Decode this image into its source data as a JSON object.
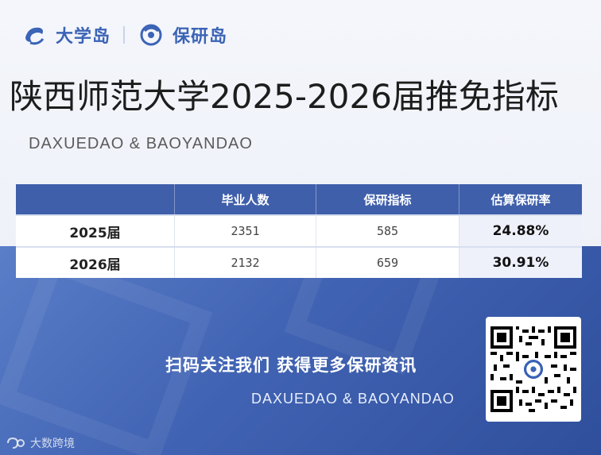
{
  "brand": {
    "name_1": "大学岛",
    "name_2": "保研岛",
    "icon_1": "daxuedao-logo-icon",
    "icon_2": "baoyandao-logo-icon",
    "color": "#3b63b6"
  },
  "title": "陕西师范大学2025-2026届推免指标",
  "subtitle": "DAXUEDAO & BAOYANDAO",
  "table": {
    "headers": [
      "",
      "毕业人数",
      "保研指标",
      "估算保研率"
    ],
    "rows": [
      {
        "year": "2025届",
        "graduates": "2351",
        "quota": "585",
        "rate": "24.88%"
      },
      {
        "year": "2026届",
        "graduates": "2132",
        "quota": "659",
        "rate": "30.91%"
      }
    ],
    "header_color": "#3f5fab"
  },
  "cta": {
    "title": "扫码关注我们  获得更多保研资讯",
    "subtitle": "DAXUEDAO & BAOYANDAO",
    "qr_icon": "qr-code-icon"
  },
  "footer": {
    "label": "大数跨境",
    "icon": "dashujingjing-logo-icon"
  }
}
